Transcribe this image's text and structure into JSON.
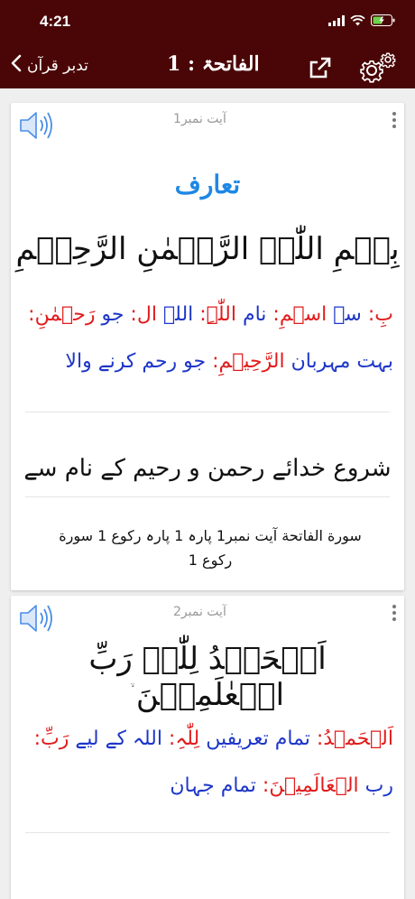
{
  "status_bar": {
    "time": "4:21"
  },
  "nav": {
    "back_label": "تدبر قرآن",
    "title": "الفاتحۃ : 1"
  },
  "icons": {
    "back": "chevron-left-icon",
    "share": "share-icon",
    "settings": "gear-icon",
    "audio": "speaker-icon",
    "menu": "kebab-menu-icon"
  },
  "colors": {
    "nav_background": "#4a0606",
    "heading_blue": "#1e88e5",
    "word_red": "#e21b1b",
    "meaning_blue": "#1d36c8"
  },
  "cards": [
    {
      "ayat_label": "آیت نمبر1",
      "heading": "تعارف",
      "arabic": "بِسۡمِ اللّٰہِ الرَّحۡمٰنِ الرَّحِیۡمِ",
      "wbw_line1": [
        {
          "word": "بِ",
          "meaning": "سے"
        },
        {
          "word": "اسۡمِ",
          "meaning": "نام"
        },
        {
          "word": "اللّٰہِ",
          "meaning": "اللہ"
        },
        {
          "word": "ال",
          "meaning": "جو"
        },
        {
          "word": "رَحۡمٰنِ",
          "meaning": ""
        }
      ],
      "wbw_line2": [
        {
          "word": "",
          "meaning": "بہت مہربان"
        },
        {
          "word": "الرَّحِیۡمِ",
          "meaning": "جو رحم کرنے والا"
        }
      ],
      "translation": "شروع خدائے رحمن و رحیم کے نام سے",
      "reference_line1": "سورة الفاتحة آیت نمبر1   پارہ 1 پارہ رکوع 1  سورة",
      "reference_line2": "رکوع 1"
    },
    {
      "ayat_label": "آیت نمبر2",
      "arabic": "اَلۡحَمۡدُ لِلّٰہِ رَبِّ الۡعٰلَمِیۡنَ",
      "ayah_mark": "ۙ",
      "wbw_line1": [
        {
          "word": "اَلۡحَمۡدُ",
          "meaning": "تمام تعریفیں"
        },
        {
          "word": "لِلّٰہِ",
          "meaning": "اللہ کے لیے"
        },
        {
          "word": "رَبِّ",
          "meaning": ""
        }
      ],
      "wbw_line2": [
        {
          "word": "",
          "meaning": "رب"
        },
        {
          "word": "الۡعَالَمِیۡنَ",
          "meaning": "تمام جہان"
        }
      ]
    }
  ]
}
